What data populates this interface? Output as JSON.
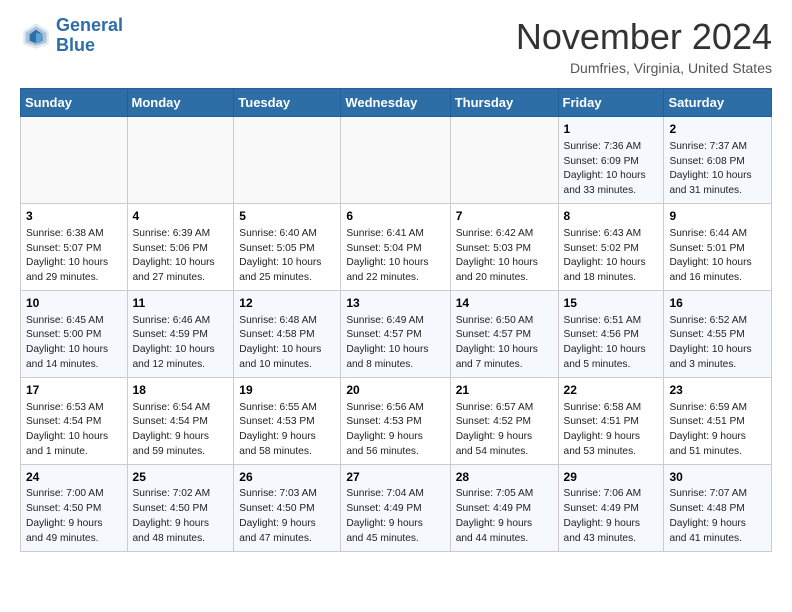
{
  "header": {
    "logo_line1": "General",
    "logo_line2": "Blue",
    "month": "November 2024",
    "location": "Dumfries, Virginia, United States"
  },
  "weekdays": [
    "Sunday",
    "Monday",
    "Tuesday",
    "Wednesday",
    "Thursday",
    "Friday",
    "Saturday"
  ],
  "weeks": [
    [
      {
        "day": "",
        "info": ""
      },
      {
        "day": "",
        "info": ""
      },
      {
        "day": "",
        "info": ""
      },
      {
        "day": "",
        "info": ""
      },
      {
        "day": "",
        "info": ""
      },
      {
        "day": "1",
        "info": "Sunrise: 7:36 AM\nSunset: 6:09 PM\nDaylight: 10 hours\nand 33 minutes."
      },
      {
        "day": "2",
        "info": "Sunrise: 7:37 AM\nSunset: 6:08 PM\nDaylight: 10 hours\nand 31 minutes."
      }
    ],
    [
      {
        "day": "3",
        "info": "Sunrise: 6:38 AM\nSunset: 5:07 PM\nDaylight: 10 hours\nand 29 minutes."
      },
      {
        "day": "4",
        "info": "Sunrise: 6:39 AM\nSunset: 5:06 PM\nDaylight: 10 hours\nand 27 minutes."
      },
      {
        "day": "5",
        "info": "Sunrise: 6:40 AM\nSunset: 5:05 PM\nDaylight: 10 hours\nand 25 minutes."
      },
      {
        "day": "6",
        "info": "Sunrise: 6:41 AM\nSunset: 5:04 PM\nDaylight: 10 hours\nand 22 minutes."
      },
      {
        "day": "7",
        "info": "Sunrise: 6:42 AM\nSunset: 5:03 PM\nDaylight: 10 hours\nand 20 minutes."
      },
      {
        "day": "8",
        "info": "Sunrise: 6:43 AM\nSunset: 5:02 PM\nDaylight: 10 hours\nand 18 minutes."
      },
      {
        "day": "9",
        "info": "Sunrise: 6:44 AM\nSunset: 5:01 PM\nDaylight: 10 hours\nand 16 minutes."
      }
    ],
    [
      {
        "day": "10",
        "info": "Sunrise: 6:45 AM\nSunset: 5:00 PM\nDaylight: 10 hours\nand 14 minutes."
      },
      {
        "day": "11",
        "info": "Sunrise: 6:46 AM\nSunset: 4:59 PM\nDaylight: 10 hours\nand 12 minutes."
      },
      {
        "day": "12",
        "info": "Sunrise: 6:48 AM\nSunset: 4:58 PM\nDaylight: 10 hours\nand 10 minutes."
      },
      {
        "day": "13",
        "info": "Sunrise: 6:49 AM\nSunset: 4:57 PM\nDaylight: 10 hours\nand 8 minutes."
      },
      {
        "day": "14",
        "info": "Sunrise: 6:50 AM\nSunset: 4:57 PM\nDaylight: 10 hours\nand 7 minutes."
      },
      {
        "day": "15",
        "info": "Sunrise: 6:51 AM\nSunset: 4:56 PM\nDaylight: 10 hours\nand 5 minutes."
      },
      {
        "day": "16",
        "info": "Sunrise: 6:52 AM\nSunset: 4:55 PM\nDaylight: 10 hours\nand 3 minutes."
      }
    ],
    [
      {
        "day": "17",
        "info": "Sunrise: 6:53 AM\nSunset: 4:54 PM\nDaylight: 10 hours\nand 1 minute."
      },
      {
        "day": "18",
        "info": "Sunrise: 6:54 AM\nSunset: 4:54 PM\nDaylight: 9 hours\nand 59 minutes."
      },
      {
        "day": "19",
        "info": "Sunrise: 6:55 AM\nSunset: 4:53 PM\nDaylight: 9 hours\nand 58 minutes."
      },
      {
        "day": "20",
        "info": "Sunrise: 6:56 AM\nSunset: 4:53 PM\nDaylight: 9 hours\nand 56 minutes."
      },
      {
        "day": "21",
        "info": "Sunrise: 6:57 AM\nSunset: 4:52 PM\nDaylight: 9 hours\nand 54 minutes."
      },
      {
        "day": "22",
        "info": "Sunrise: 6:58 AM\nSunset: 4:51 PM\nDaylight: 9 hours\nand 53 minutes."
      },
      {
        "day": "23",
        "info": "Sunrise: 6:59 AM\nSunset: 4:51 PM\nDaylight: 9 hours\nand 51 minutes."
      }
    ],
    [
      {
        "day": "24",
        "info": "Sunrise: 7:00 AM\nSunset: 4:50 PM\nDaylight: 9 hours\nand 49 minutes."
      },
      {
        "day": "25",
        "info": "Sunrise: 7:02 AM\nSunset: 4:50 PM\nDaylight: 9 hours\nand 48 minutes."
      },
      {
        "day": "26",
        "info": "Sunrise: 7:03 AM\nSunset: 4:50 PM\nDaylight: 9 hours\nand 47 minutes."
      },
      {
        "day": "27",
        "info": "Sunrise: 7:04 AM\nSunset: 4:49 PM\nDaylight: 9 hours\nand 45 minutes."
      },
      {
        "day": "28",
        "info": "Sunrise: 7:05 AM\nSunset: 4:49 PM\nDaylight: 9 hours\nand 44 minutes."
      },
      {
        "day": "29",
        "info": "Sunrise: 7:06 AM\nSunset: 4:49 PM\nDaylight: 9 hours\nand 43 minutes."
      },
      {
        "day": "30",
        "info": "Sunrise: 7:07 AM\nSunset: 4:48 PM\nDaylight: 9 hours\nand 41 minutes."
      }
    ]
  ]
}
